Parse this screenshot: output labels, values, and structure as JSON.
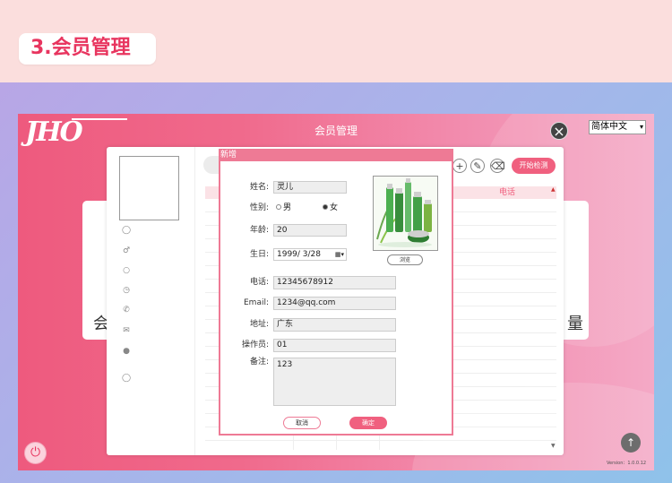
{
  "heading": "3.会员管理",
  "app": {
    "logo": "JHO",
    "title": "会员管理",
    "language": "简体中文",
    "version": "Version：1.0.0.12",
    "close_symbol": "×"
  },
  "background_card": {
    "left_glyph": "会",
    "right_glyph": "量"
  },
  "toolbar": {
    "start_label": "开始检测"
  },
  "table": {
    "columns": [
      "电话"
    ]
  },
  "dialog": {
    "title": "新增",
    "fields": {
      "name": {
        "label": "姓名:",
        "value": "灵儿"
      },
      "gender": {
        "label": "性别:",
        "options": [
          "男",
          "女"
        ],
        "selected": "女"
      },
      "age": {
        "label": "年龄:",
        "value": "20"
      },
      "birthday": {
        "label": "生日:",
        "value": "1999/  3/28"
      },
      "phone": {
        "label": "电话:",
        "value": "12345678912"
      },
      "email": {
        "label": "Email:",
        "value": "1234@qq.com"
      },
      "address": {
        "label": "地址:",
        "value": "广东"
      },
      "operator": {
        "label": "操作员:",
        "value": "01"
      },
      "note": {
        "label": "备注:",
        "value": "123"
      }
    },
    "browse_label": "浏览",
    "cancel_label": "取消",
    "confirm_label": "确定"
  },
  "colors": {
    "accent": "#f0607f",
    "heading_text": "#e8355f",
    "dialog_border": "#ee7a95"
  },
  "icons": [
    "user-icon",
    "male-icon",
    "cake-icon",
    "clock-icon",
    "phone-icon",
    "mail-icon",
    "location-icon",
    "operator-icon",
    "plus-icon",
    "edit-icon",
    "delete-icon",
    "power-icon",
    "upload-icon",
    "calendar-icon"
  ]
}
